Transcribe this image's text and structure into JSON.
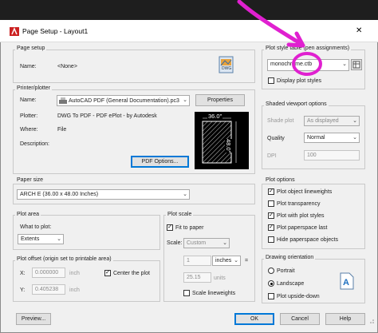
{
  "window": {
    "title": "Page Setup - Layout1",
    "close": "✕"
  },
  "page_setup": {
    "group": "Page setup",
    "name_label": "Name:",
    "name_value": "<None>",
    "dwg_badge": "DWG"
  },
  "printer": {
    "group": "Printer/plotter",
    "name_label": "Name:",
    "name_value": "AutoCAD PDF (General Documentation).pc3",
    "properties_btn": "Properties",
    "plotter_label": "Plotter:",
    "plotter_value": "DWG To PDF - PDF ePlot - by Autodesk",
    "where_label": "Where:",
    "where_value": "File",
    "description_label": "Description:",
    "pdf_options_btn": "PDF Options...",
    "preview_width": "36.0\"",
    "preview_height": "48.0\""
  },
  "paper_size": {
    "group": "Paper size",
    "value": "ARCH E (36.00 x 48.00 Inches)"
  },
  "plot_area": {
    "group": "Plot area",
    "what_label": "What to plot:",
    "what_value": "Extents"
  },
  "plot_offset": {
    "group": "Plot offset (origin set to printable area)",
    "x_label": "X:",
    "x_value": "0.000000",
    "x_unit": "inch",
    "y_label": "Y:",
    "y_value": "0.405238",
    "y_unit": "inch",
    "center_label": "Center the plot"
  },
  "plot_scale": {
    "group": "Plot scale",
    "fit_label": "Fit to paper",
    "scale_label": "Scale:",
    "scale_value": "Custom",
    "num_value": "1",
    "num_unit": "inches",
    "equals": "=",
    "units_value": "25.15",
    "units_label": "units",
    "lineweights_label": "Scale lineweights"
  },
  "plot_style": {
    "group": "Plot style table (pen assignments)",
    "value": "monochrome.ctb",
    "display_label": "Display plot styles"
  },
  "shaded": {
    "group": "Shaded viewport options",
    "shade_label": "Shade plot",
    "shade_value": "As displayed",
    "quality_label": "Quality",
    "quality_value": "Normal",
    "dpi_label": "DPI",
    "dpi_value": "100"
  },
  "plot_options": {
    "group": "Plot options",
    "items": [
      {
        "label": "Plot object lineweights",
        "checked": true
      },
      {
        "label": "Plot transparency",
        "checked": false
      },
      {
        "label": "Plot with plot styles",
        "checked": true
      },
      {
        "label": "Plot paperspace last",
        "checked": true
      },
      {
        "label": "Hide paperspace objects",
        "checked": false
      }
    ]
  },
  "orientation": {
    "group": "Drawing orientation",
    "portrait": "Portrait",
    "landscape": "Landscape",
    "upside_down": "Plot upside-down",
    "selected": "Landscape"
  },
  "footer": {
    "preview": "Preview...",
    "ok": "OK",
    "cancel": "Cancel",
    "help": "Help"
  },
  "annotation_color": "#e020d0",
  "accent": "#0078d7"
}
